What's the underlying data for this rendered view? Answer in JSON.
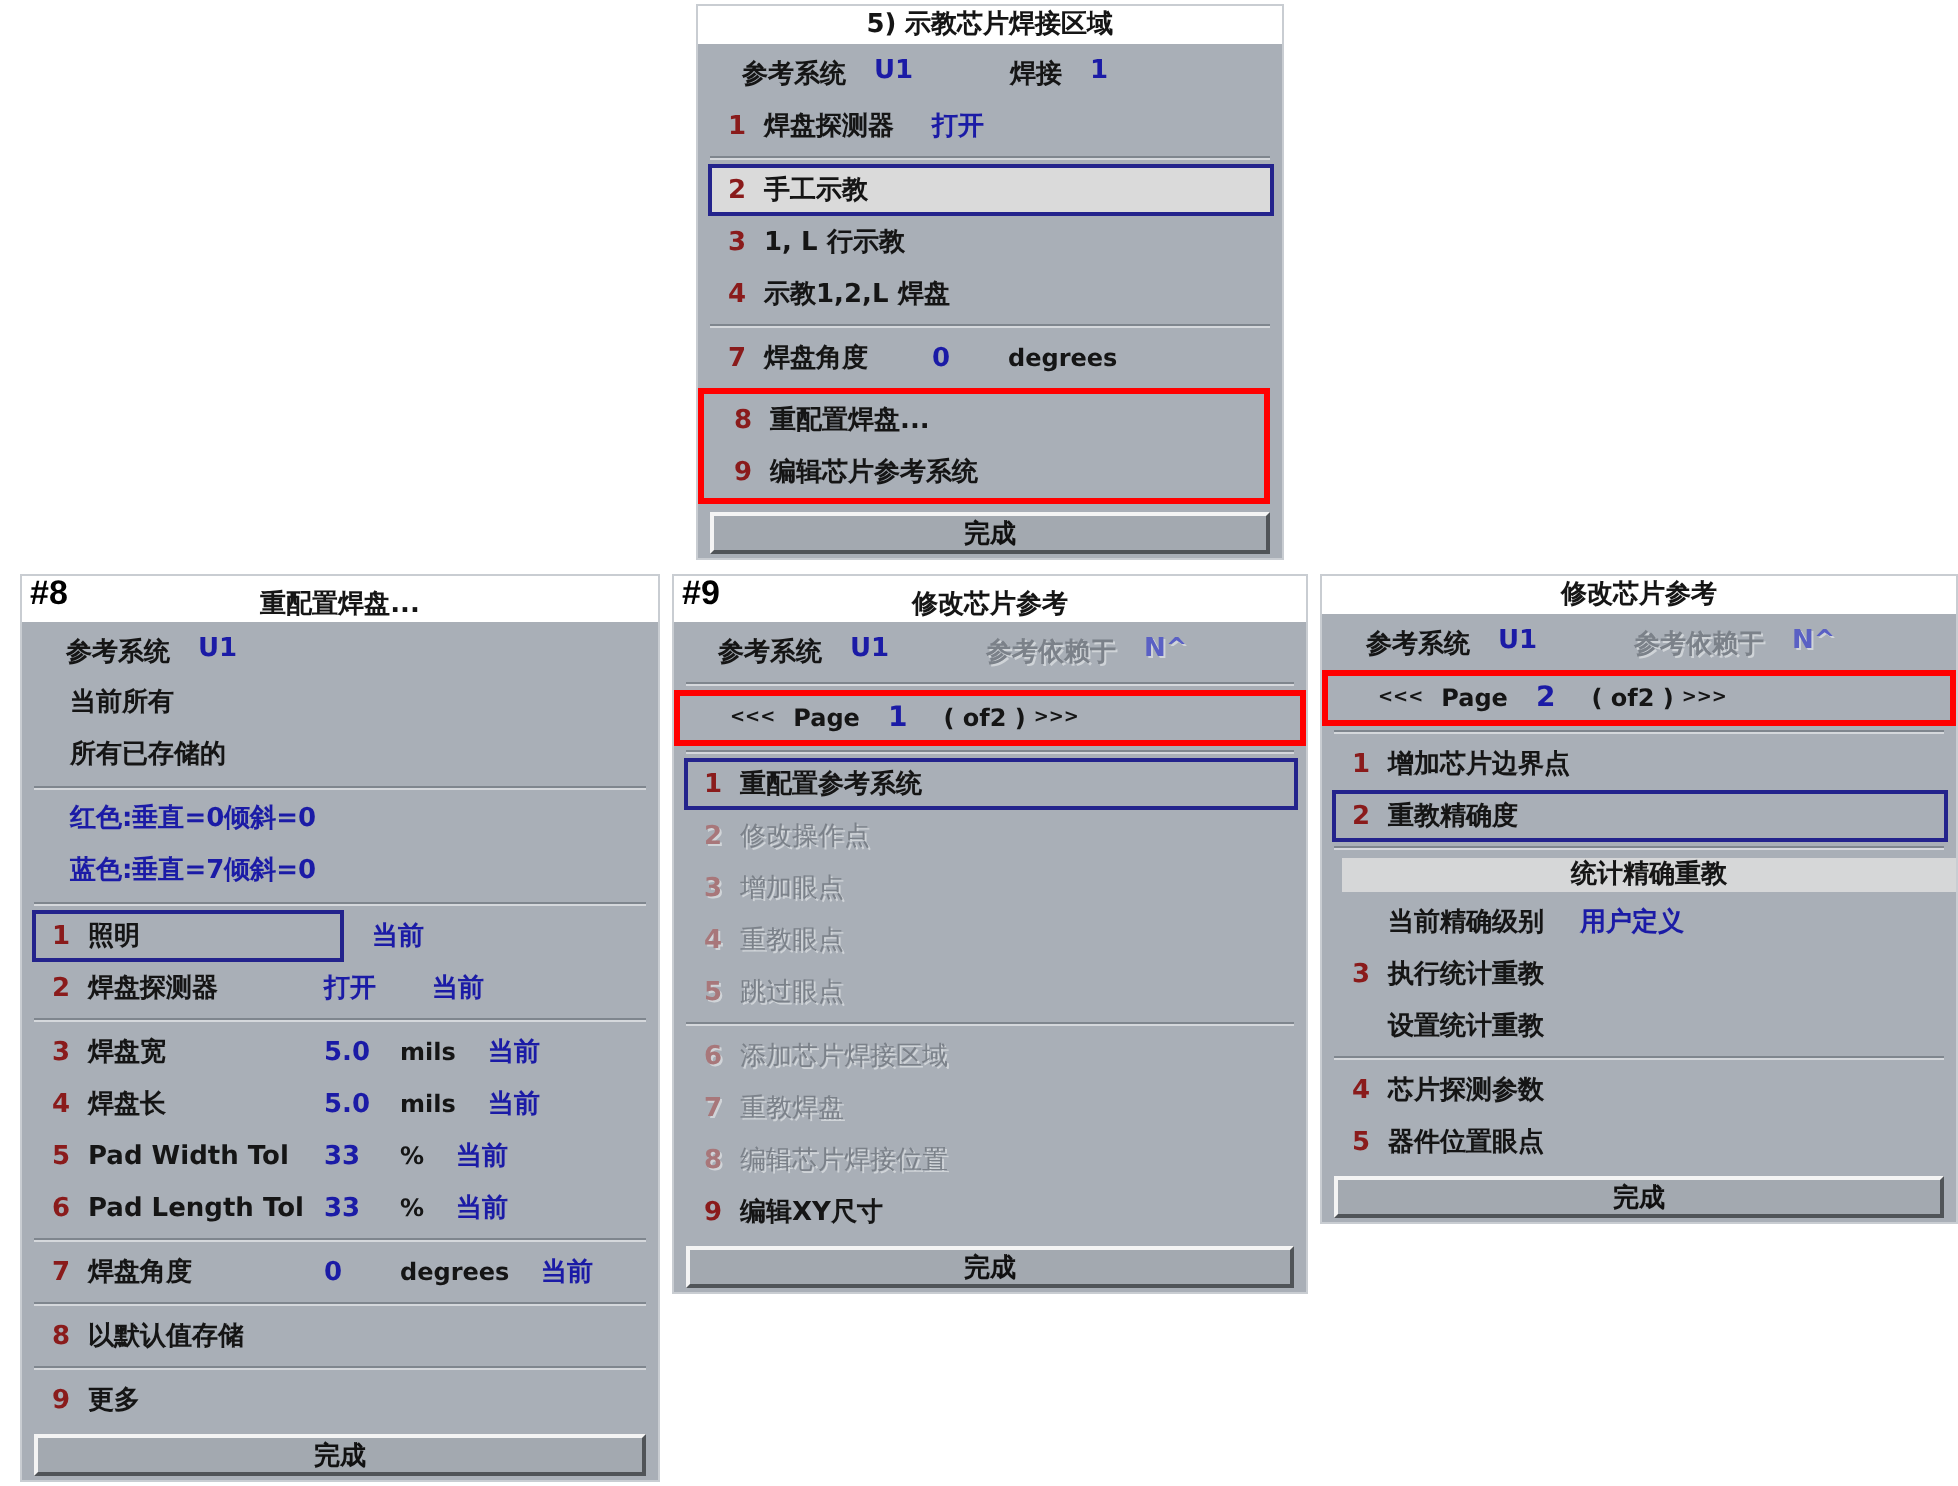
{
  "top_panel": {
    "title": "5) 示教芯片焊接区域",
    "filled_selection": true,
    "rows": [
      {
        "kind": "info",
        "pairs": [
          {
            "label": "参考系统",
            "value": "U1",
            "disabled": false
          },
          {
            "label": "焊接",
            "value": "1",
            "disabled": false
          }
        ]
      },
      {
        "kind": "option",
        "number": "1",
        "label": "焊盘探测器",
        "value": "打开",
        "selected": false,
        "disabled": false
      },
      {
        "kind": "separator"
      },
      {
        "kind": "option",
        "number": "2",
        "label": "手工示教",
        "selected": true,
        "disabled": false
      },
      {
        "kind": "option",
        "number": "3",
        "label": "1, L 行示教",
        "selected": false,
        "disabled": false
      },
      {
        "kind": "option",
        "number": "4",
        "label": "示教1,2,L 焊盘",
        "selected": false,
        "disabled": false
      },
      {
        "kind": "separator"
      },
      {
        "kind": "option",
        "number": "7",
        "label": "焊盘角度",
        "value": "0",
        "unit": "degrees",
        "selected": false,
        "disabled": false
      },
      {
        "kind": "group",
        "highlighted": true,
        "rows": [
          {
            "kind": "option",
            "number": "8",
            "label": "重配置焊盘...",
            "selected": false,
            "disabled": false
          },
          {
            "kind": "option",
            "number": "9",
            "label": "编辑芯片参考系统",
            "selected": false,
            "disabled": false
          }
        ]
      }
    ],
    "done_button": "完成"
  },
  "bottom_panels": [
    {
      "tag": "#8",
      "title": "重配置焊盘...",
      "filled_selection": false,
      "rows": [
        {
          "kind": "info",
          "pairs": [
            {
              "label": "参考系统",
              "value": "U1",
              "disabled": false
            }
          ]
        },
        {
          "kind": "text",
          "text": "当前所有"
        },
        {
          "kind": "text",
          "text": "所有已存储的"
        },
        {
          "kind": "separator"
        },
        {
          "kind": "note",
          "text": "红色:垂直=0倾斜=0"
        },
        {
          "kind": "note",
          "text": "蓝色:垂直=7倾斜=0"
        },
        {
          "kind": "separator"
        },
        {
          "kind": "option",
          "number": "1",
          "label": "照明",
          "status": "当前",
          "selected": true,
          "disabled": false
        },
        {
          "kind": "option",
          "number": "2",
          "label": "焊盘探测器",
          "value": "打开",
          "status": "当前",
          "selected": false,
          "disabled": false
        },
        {
          "kind": "separator"
        },
        {
          "kind": "option",
          "number": "3",
          "label": "焊盘宽",
          "value": "5.0",
          "unit": "mils",
          "status": "当前",
          "selected": false,
          "disabled": false
        },
        {
          "kind": "option",
          "number": "4",
          "label": "焊盘长",
          "value": "5.0",
          "unit": "mils",
          "status": "当前",
          "selected": false,
          "disabled": false
        },
        {
          "kind": "option",
          "number": "5",
          "label": "Pad Width Tol",
          "value": "33",
          "unit": "%",
          "status": "当前",
          "selected": false,
          "disabled": false
        },
        {
          "kind": "option",
          "number": "6",
          "label": "Pad Length Tol",
          "value": "33",
          "unit": "%",
          "status": "当前",
          "selected": false,
          "disabled": false
        },
        {
          "kind": "separator"
        },
        {
          "kind": "option",
          "number": "7",
          "label": "焊盘角度",
          "value": "0",
          "unit": "degrees",
          "status": "当前",
          "selected": false,
          "disabled": false
        },
        {
          "kind": "separator"
        },
        {
          "kind": "option",
          "number": "8",
          "label": "以默认值存储",
          "selected": false,
          "disabled": false
        },
        {
          "kind": "separator"
        },
        {
          "kind": "option",
          "number": "9",
          "label": "更多",
          "selected": false,
          "disabled": false
        }
      ],
      "done_button": "完成"
    },
    {
      "tag": "#9",
      "title": "修改芯片参考",
      "filled_selection": false,
      "rows": [
        {
          "kind": "info",
          "pairs": [
            {
              "label": "参考系统",
              "value": "U1",
              "disabled": false
            },
            {
              "label": "参考依赖于",
              "value": "N^",
              "disabled": true
            }
          ]
        },
        {
          "kind": "separator"
        },
        {
          "kind": "pager",
          "highlighted": true,
          "prev": "<<<",
          "label": "Page",
          "page": "1",
          "total": "( of2 )",
          "next": ">>>"
        },
        {
          "kind": "separator"
        },
        {
          "kind": "option",
          "number": "1",
          "label": "重配置参考系统",
          "selected": true,
          "disabled": false
        },
        {
          "kind": "option",
          "number": "2",
          "label": "修改操作点",
          "selected": false,
          "disabled": true
        },
        {
          "kind": "option",
          "number": "3",
          "label": "增加眼点",
          "selected": false,
          "disabled": true
        },
        {
          "kind": "option",
          "number": "4",
          "label": "重教眼点",
          "selected": false,
          "disabled": true
        },
        {
          "kind": "option",
          "number": "5",
          "label": "跳过眼点",
          "selected": false,
          "disabled": true
        },
        {
          "kind": "separator"
        },
        {
          "kind": "option",
          "number": "6",
          "label": "添加芯片焊接区域",
          "selected": false,
          "disabled": true
        },
        {
          "kind": "option",
          "number": "7",
          "label": "重教焊盘",
          "selected": false,
          "disabled": true
        },
        {
          "kind": "option",
          "number": "8",
          "label": "编辑芯片焊接位置",
          "selected": false,
          "disabled": true
        },
        {
          "kind": "option",
          "number": "9",
          "label": "编辑XY尺寸",
          "selected": false,
          "disabled": false
        }
      ],
      "done_button": "完成"
    },
    {
      "title": "修改芯片参考",
      "filled_selection": false,
      "rows": [
        {
          "kind": "info",
          "pairs": [
            {
              "label": "参考系统",
              "value": "U1",
              "disabled": false
            },
            {
              "label": "参考依赖于",
              "value": "N^",
              "disabled": true
            }
          ]
        },
        {
          "kind": "pager",
          "highlighted": true,
          "prev": "<<<",
          "label": "Page",
          "page": "2",
          "total": "( of2 )",
          "next": ">>>"
        },
        {
          "kind": "separator"
        },
        {
          "kind": "option",
          "number": "1",
          "label": "增加芯片边界点",
          "selected": false,
          "disabled": false
        },
        {
          "kind": "option",
          "number": "2",
          "label": "重教精确度",
          "selected": true,
          "disabled": false
        },
        {
          "kind": "separator"
        },
        {
          "kind": "section",
          "text": "统计精确重教"
        },
        {
          "kind": "option",
          "label": "当前精确级别",
          "value": "用户定义",
          "selected": false,
          "disabled": false
        },
        {
          "kind": "option",
          "number": "3",
          "label": "执行统计重教",
          "selected": false,
          "disabled": false
        },
        {
          "kind": "option",
          "label": "设置统计重教",
          "selected": false,
          "disabled": false
        },
        {
          "kind": "separator"
        },
        {
          "kind": "option",
          "number": "4",
          "label": "芯片探测参数",
          "selected": false,
          "disabled": false
        },
        {
          "kind": "option",
          "number": "5",
          "label": "器件位置眼点",
          "selected": false,
          "disabled": false
        }
      ],
      "done_button": "完成"
    }
  ]
}
